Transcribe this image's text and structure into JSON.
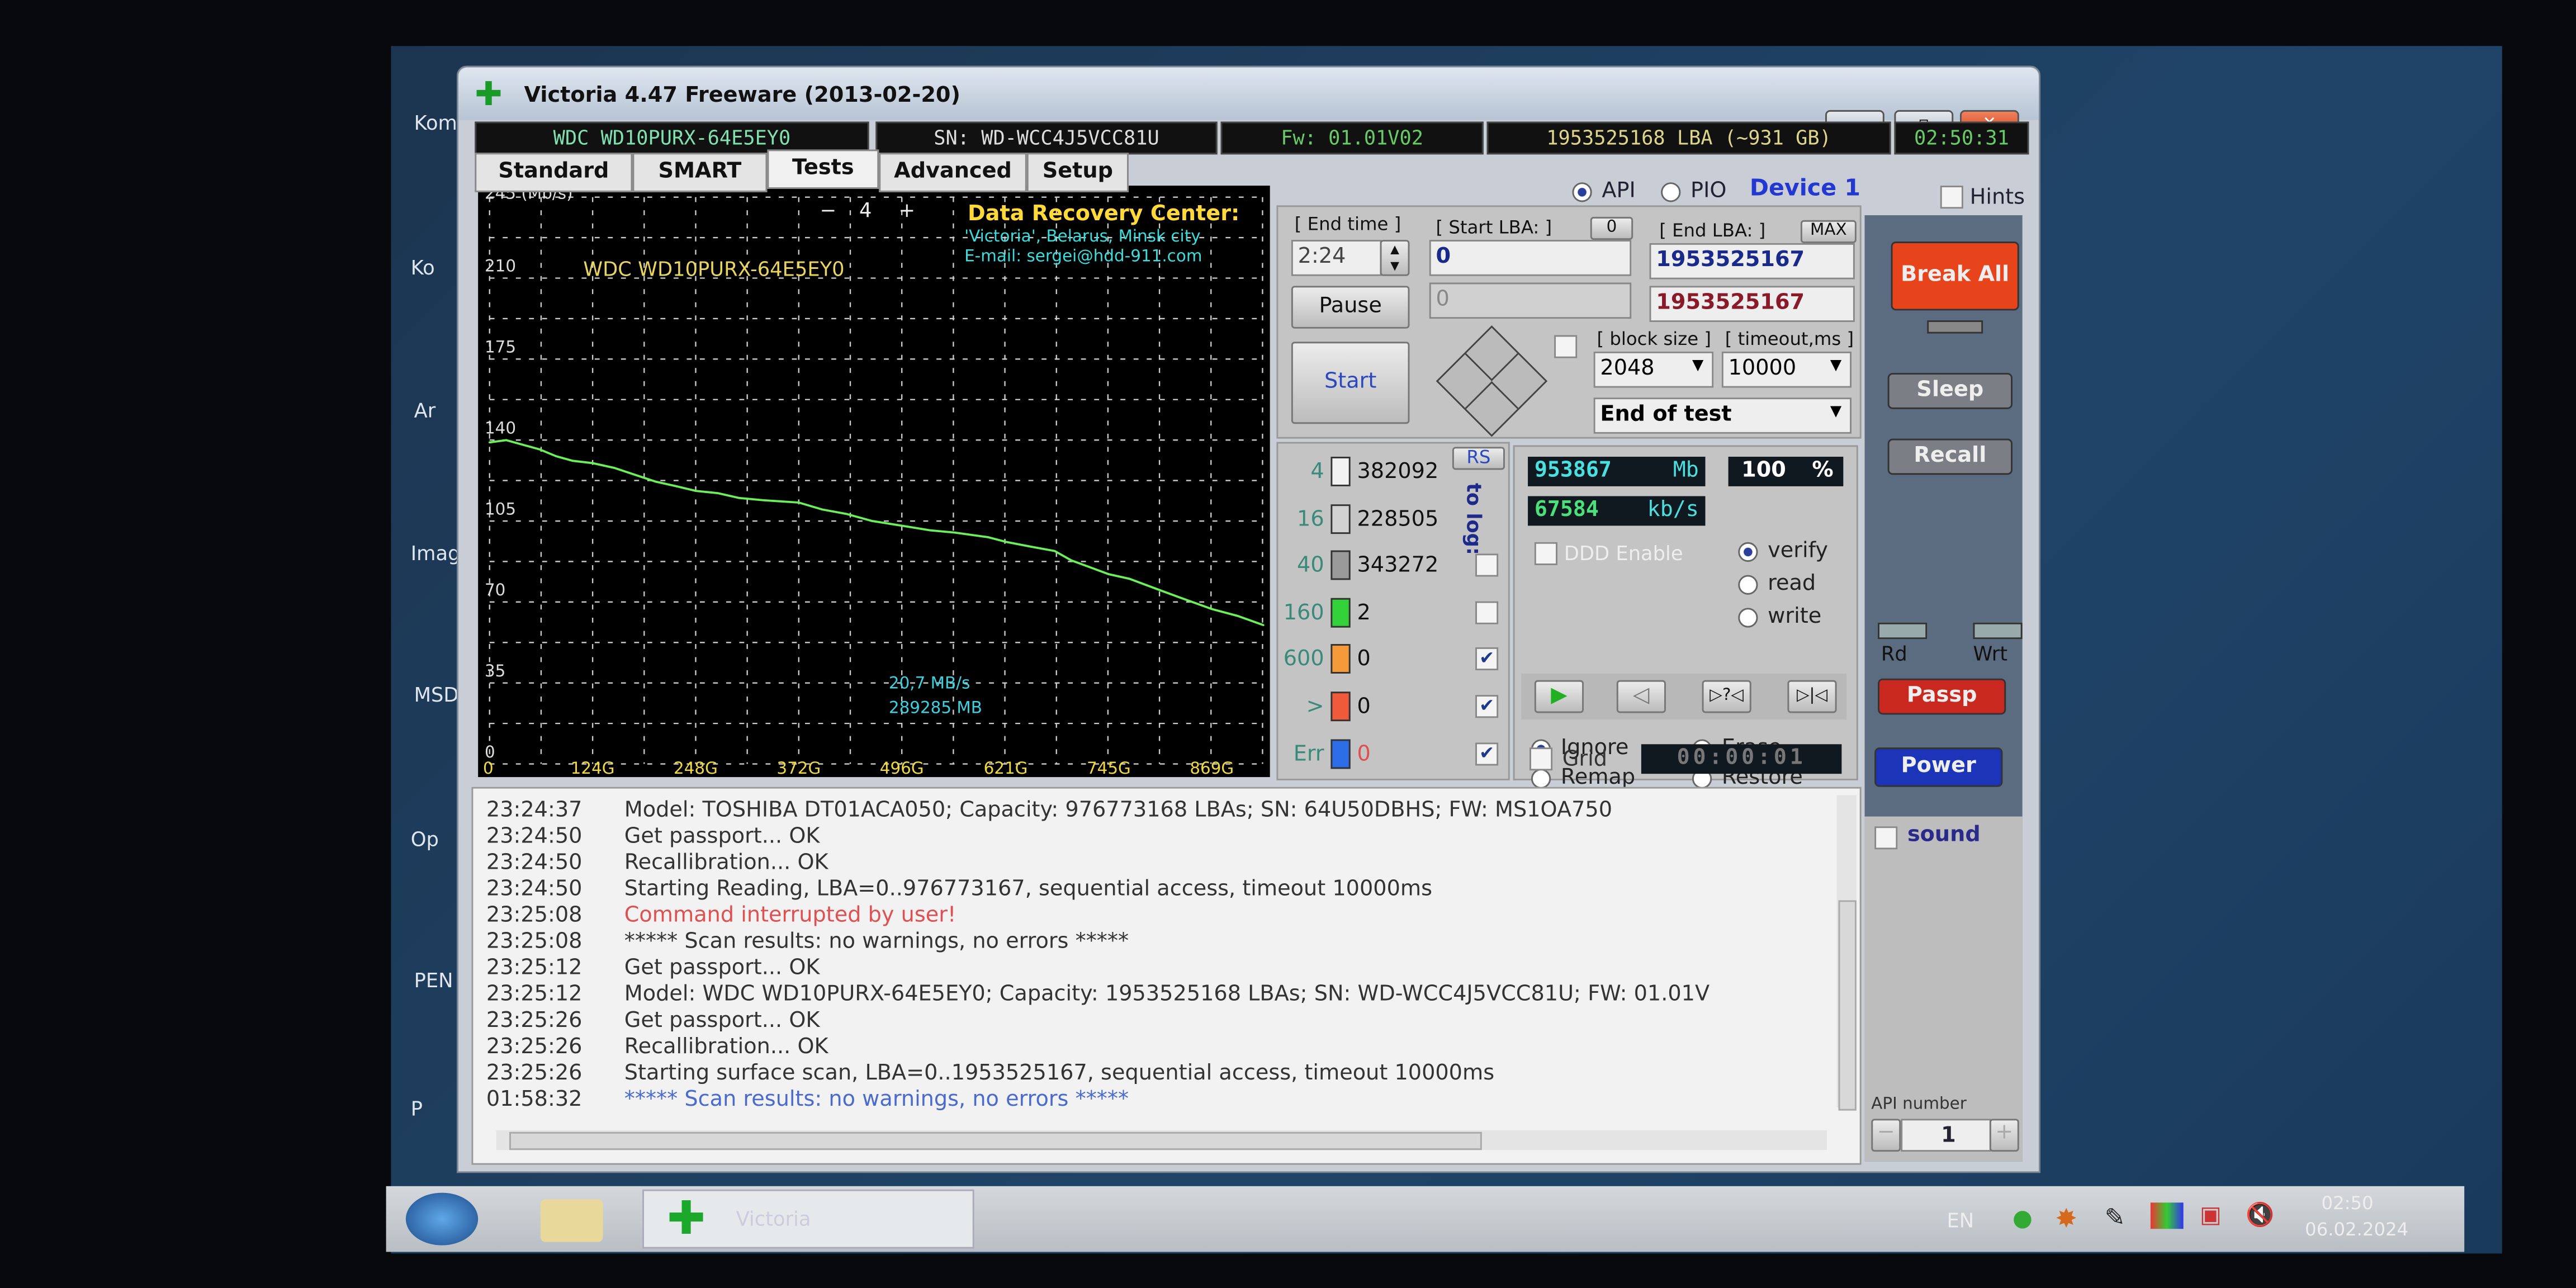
{
  "desktop": {
    "icon_labels": [
      "Kom",
      "Ko",
      "Ar",
      "Imag",
      "MSD",
      "Op",
      "PEN",
      "P"
    ]
  },
  "window": {
    "title": "Victoria 4.47  Freeware (2013-02-20)",
    "minimize": "–",
    "maximize": "▫",
    "close": "✕"
  },
  "infobar": {
    "model": "WDC WD10PURX-64E5EY0",
    "serial": "SN: WD-WCC4J5VCC81U",
    "firmware": "Fw: 01.01V02",
    "capacity": "1953525168 LBA (~931 GB)",
    "clock": "02:50:31"
  },
  "tabs": [
    {
      "label": "Standard"
    },
    {
      "label": "SMART"
    },
    {
      "label": "Tests",
      "active": true
    },
    {
      "label": "Advanced"
    },
    {
      "label": "Setup"
    }
  ],
  "interface": {
    "api_label": "API",
    "pio_label": "PIO",
    "selected": "API",
    "device": "Device 1",
    "hints_label": "Hints"
  },
  "chart": {
    "zoom_minus": "−",
    "zoom_value": "4",
    "zoom_plus": "+",
    "drc_title": "Data Recovery Center:",
    "drc_line1": "'Victoria', Belarus, Minsk city",
    "drc_line2": "E-mail: sergei@hdd-911.com",
    "speed_readout": "20,7 MB/s",
    "position_readout": "289285 MB"
  },
  "chart_data": {
    "type": "line",
    "title": "WDC WD10PURX-64E5EY0",
    "ylabel": "245 (Mb/s)",
    "ylim": [
      0,
      245
    ],
    "xlim": [
      0,
      931
    ],
    "yticks": [
      0,
      35,
      70,
      105,
      140,
      175,
      210
    ],
    "xticks": [
      {
        "v": 124,
        "label": "124G"
      },
      {
        "v": 248,
        "label": "248G"
      },
      {
        "v": 372,
        "label": "372G"
      },
      {
        "v": 496,
        "label": "496G"
      },
      {
        "v": 621,
        "label": "621G"
      },
      {
        "v": 745,
        "label": "745G"
      },
      {
        "v": 869,
        "label": "869G"
      }
    ],
    "x_zero_label": "0",
    "grid": true,
    "line_color": "#6cf05a",
    "series": [
      {
        "x": [
          0,
          20,
          40,
          60,
          80,
          100,
          124,
          150,
          175,
          200,
          225,
          248,
          275,
          300,
          330,
          372,
          400,
          430,
          460,
          496,
          530,
          560,
          600,
          621,
          650,
          680,
          700,
          745,
          770,
          800,
          830,
          869,
          900,
          931
        ],
        "values": [
          139,
          140,
          138,
          136,
          133,
          131,
          130,
          128,
          125,
          122,
          120,
          118,
          117,
          115,
          114,
          113,
          110,
          108,
          105,
          103,
          101,
          100,
          98,
          96,
          94,
          92,
          88,
          82,
          80,
          76,
          72,
          67,
          64,
          60
        ]
      }
    ]
  },
  "controls": {
    "end_time_label": "[ End time ]",
    "end_time_value": "2:24",
    "start_lba_label": "[ Start LBA: ]",
    "start_lba_reset": "0",
    "start_lba_value": "0",
    "start_lba_current": "0",
    "end_lba_label": "[ End LBA: ]",
    "end_lba_max": "MAX",
    "end_lba_value": "1953525167",
    "end_lba_current": "1953525167",
    "pause": "Pause",
    "start": "Start",
    "block_size_label": "[ block size ]",
    "block_size": "2048",
    "timeout_label": "[ timeout,ms ]",
    "timeout": "10000",
    "end_action": "End of test"
  },
  "stats": {
    "rs": "RS",
    "to_log": "to log:",
    "rows": [
      {
        "label": "4",
        "count": "382092",
        "color": "#f2f2f2",
        "log": null
      },
      {
        "label": "16",
        "count": "228505",
        "color": "#d2d2d2",
        "log": null
      },
      {
        "label": "40",
        "count": "343272",
        "color": "#9a9a9a",
        "log": false
      },
      {
        "label": "160",
        "count": "2",
        "color": "#33d13a",
        "log": false
      },
      {
        "label": "600",
        "count": "0",
        "color": "#f59a3a",
        "log": true
      },
      {
        "label": ">",
        "count": "0",
        "color": "#ef5a3a",
        "log": true
      },
      {
        "label": "Err",
        "count": "0",
        "color": "#2d6ee8",
        "log": true
      }
    ]
  },
  "progress": {
    "mb_done": "953867",
    "mb_unit": "Mb",
    "percent": "100",
    "percent_unit": "%",
    "percent_value": 100,
    "speed": "67584",
    "speed_unit": "kb/s",
    "ddd_label": "DDD Enable",
    "modes": [
      {
        "label": "verify",
        "on": true
      },
      {
        "label": "read",
        "on": false
      },
      {
        "label": "write",
        "on": false
      }
    ],
    "actions": [
      {
        "label": "Ignore",
        "on": true
      },
      {
        "label": "Erase",
        "on": false
      },
      {
        "label": "Remap",
        "on": false
      },
      {
        "label": "Restore",
        "on": false
      }
    ],
    "grid_label": "Grid",
    "timer": "00:00:01"
  },
  "sidebar": {
    "break_all": "Break All",
    "sleep": "Sleep",
    "recall": "Recall",
    "rd": "Rd",
    "wrt": "Wrt",
    "passp": "Passp",
    "power": "Power",
    "sound": "sound",
    "api_number_label": "API number",
    "api_number": "1",
    "minus": "−",
    "plus": "+"
  },
  "log": [
    {
      "time": "23:24:37",
      "text": "Model: TOSHIBA DT01ACA050; Capacity: 976773168 LBAs; SN: 64U50DBHS; FW: MS1OA750",
      "kind": "normal"
    },
    {
      "time": "23:24:50",
      "text": "Get passport... OK",
      "kind": "normal"
    },
    {
      "time": "23:24:50",
      "text": "Recallibration... OK",
      "kind": "normal"
    },
    {
      "time": "23:24:50",
      "text": "Starting Reading, LBA=0..976773167, sequential access, timeout 10000ms",
      "kind": "normal"
    },
    {
      "time": "23:25:08",
      "text": "Command interrupted by user!",
      "kind": "error"
    },
    {
      "time": "23:25:08",
      "text": "***** Scan results: no warnings, no errors *****",
      "kind": "normal"
    },
    {
      "time": "23:25:12",
      "text": "Get passport... OK",
      "kind": "normal"
    },
    {
      "time": "23:25:12",
      "text": "Model: WDC WD10PURX-64E5EY0; Capacity: 1953525168 LBAs; SN: WD-WCC4J5VCC81U; FW: 01.01V",
      "kind": "normal"
    },
    {
      "time": "23:25:26",
      "text": "Get passport... OK",
      "kind": "normal"
    },
    {
      "time": "23:25:26",
      "text": "Recallibration... OK",
      "kind": "normal"
    },
    {
      "time": "23:25:26",
      "text": "Starting surface scan, LBA=0..1953525167, sequential access, timeout 10000ms",
      "kind": "normal"
    },
    {
      "time": "01:58:32",
      "text": "***** Scan results: no warnings, no errors *****",
      "kind": "result"
    }
  ],
  "taskbar": {
    "app_label": "Victoria",
    "lang": "EN",
    "time": "02:50",
    "date": "06.02.2024"
  },
  "colors": {
    "error": "#e05050",
    "result": "#4a6ad0",
    "break": "#e8441c",
    "passp": "#c8281e",
    "power": "#1c34b8"
  }
}
